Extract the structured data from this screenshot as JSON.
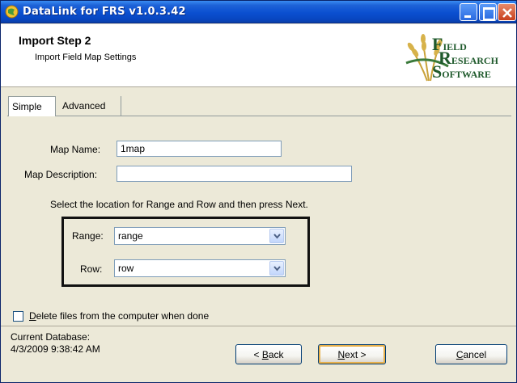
{
  "window": {
    "title": "DataLink for FRS v1.0.3.42"
  },
  "header": {
    "step_title": "Import Step 2",
    "step_subtitle": "Import Field Map Settings",
    "logo": {
      "line1_initial": "F",
      "line1_rest": "IELD",
      "line2_initial": "R",
      "line2_rest": "ESEARCH",
      "line3_initial": "S",
      "line3_rest": "OFTWARE"
    }
  },
  "tabs": [
    {
      "label": "Simple",
      "selected": true
    },
    {
      "label": "Advanced",
      "selected": false
    }
  ],
  "form": {
    "map_name_label": "Map Name:",
    "map_name_value": "1map",
    "map_description_label": "Map Description:",
    "map_description_value": "",
    "instruction": "Select the location for Range and Row and then press Next.",
    "range_label": "Range:",
    "range_value": "range",
    "row_label": "Row:",
    "row_value": "row"
  },
  "options": {
    "delete_files_checked": false,
    "delete_files_first_letter": "D",
    "delete_files_rest": "elete files from the computer when done"
  },
  "footer": {
    "current_db_label": "Current Database:",
    "current_db_value": "4/3/2009 9:38:42 AM",
    "back_prefix": "< ",
    "back_key": "B",
    "back_rest": "ack",
    "next_key": "N",
    "next_rest": "ext >",
    "cancel_key": "C",
    "cancel_rest": "ancel"
  },
  "colors": {
    "titlebar": "#0a4fd0",
    "dialog_bg": "#ece9d8",
    "logo_green": "#1f5a2c"
  }
}
